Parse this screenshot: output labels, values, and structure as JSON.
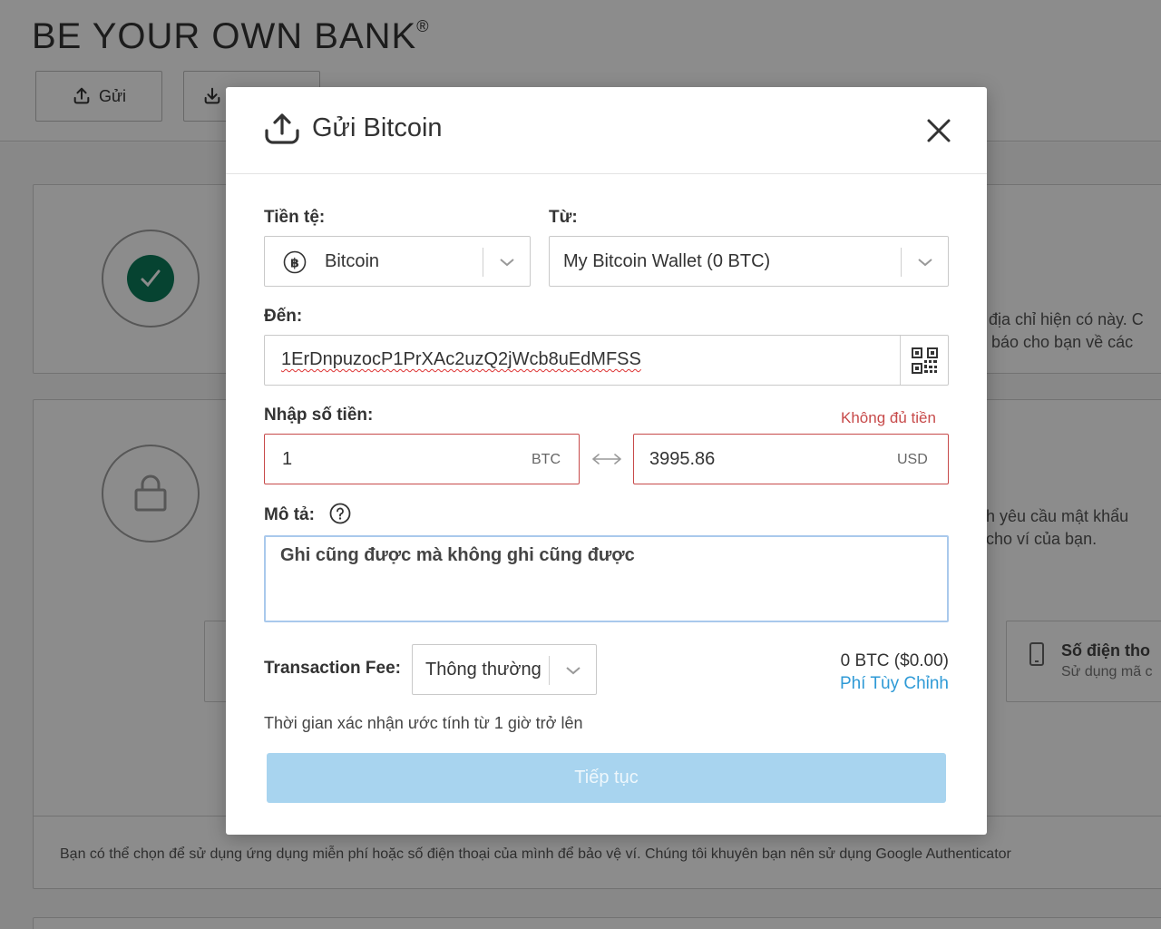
{
  "background": {
    "brand": "BE YOUR OWN BANK",
    "brand_mark": "®",
    "send_button": "Gửi",
    "card1_line1": "địa chỉ hiện có này. C",
    "card1_line2": "báo cho bạn về các",
    "card2_line1": "h yêu cầu mật khẩu",
    "card2_line2": "cho ví của bạn.",
    "phone_title": "Số điện tho",
    "phone_sub": "Sử dụng mã c",
    "footer_text": "Bạn có thể chọn để sử dụng ứng dụng miễn phí hoặc số điện thoại của mình để bảo vệ ví. Chúng tôi khuyên bạn nên sử dụng Google Authenticator"
  },
  "modal": {
    "title": "Gửi Bitcoin",
    "currency_label": "Tiền tệ:",
    "currency_value": "Bitcoin",
    "from_label": "Từ:",
    "from_value": "My Bitcoin Wallet (0 BTC)",
    "to_label": "Đến:",
    "to_value": "1ErDnpuzocP1PrXAc2uzQ2jWcb8uEdMFSS",
    "amount_label": "Nhập số tiền:",
    "amount_error": "Không đủ tiền",
    "amount_btc": "1",
    "amount_btc_unit": "BTC",
    "amount_usd": "3995.86",
    "amount_usd_unit": "USD",
    "description_label": "Mô tả:",
    "description_value": "Ghi cũng được mà không ghi cũng được",
    "fee_label": "Transaction Fee:",
    "fee_value": "Thông thường",
    "fee_amount": "0 BTC ($0.00)",
    "custom_fee_link": "Phí Tùy Chỉnh",
    "estimate_text": "Thời gian xác nhận ước tính từ 1 giờ trở lên",
    "continue_button": "Tiếp tục"
  },
  "colors": {
    "error": "#c74a4a",
    "link": "#2f9ad6",
    "primary_disabled": "#a8d4ef",
    "check_green": "#0c7a5a"
  }
}
